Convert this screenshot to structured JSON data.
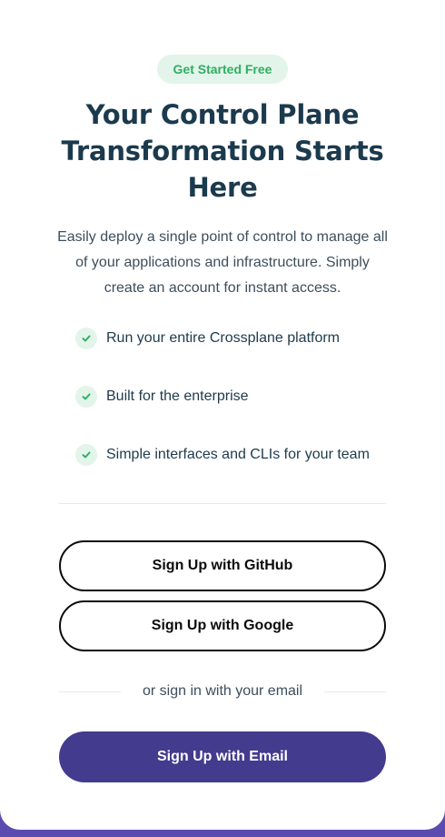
{
  "badge": "Get Started Free",
  "title": "Your Control Plane Transformation Starts Here",
  "description": "Easily deploy a single point of control to manage all of your applications and infrastructure. Simply create an account for instant access.",
  "features": [
    {
      "text": "Run your entire Crossplane platform",
      "icon": "check-icon"
    },
    {
      "text": "Built for the enterprise",
      "icon": "check-icon"
    },
    {
      "text": "Simple interfaces and CLIs for your team",
      "icon": "check-icon"
    }
  ],
  "buttons": {
    "github": "Sign Up with GitHub",
    "google": "Sign Up with Google",
    "email": "Sign Up with Email"
  },
  "separator": "or sign in with your email",
  "colors": {
    "accent_green": "#2fae63",
    "badge_bg": "#e3f5ea",
    "primary_button": "#433b8e",
    "heading": "#1b3a4d",
    "page_bg": "#5b4bb0"
  }
}
